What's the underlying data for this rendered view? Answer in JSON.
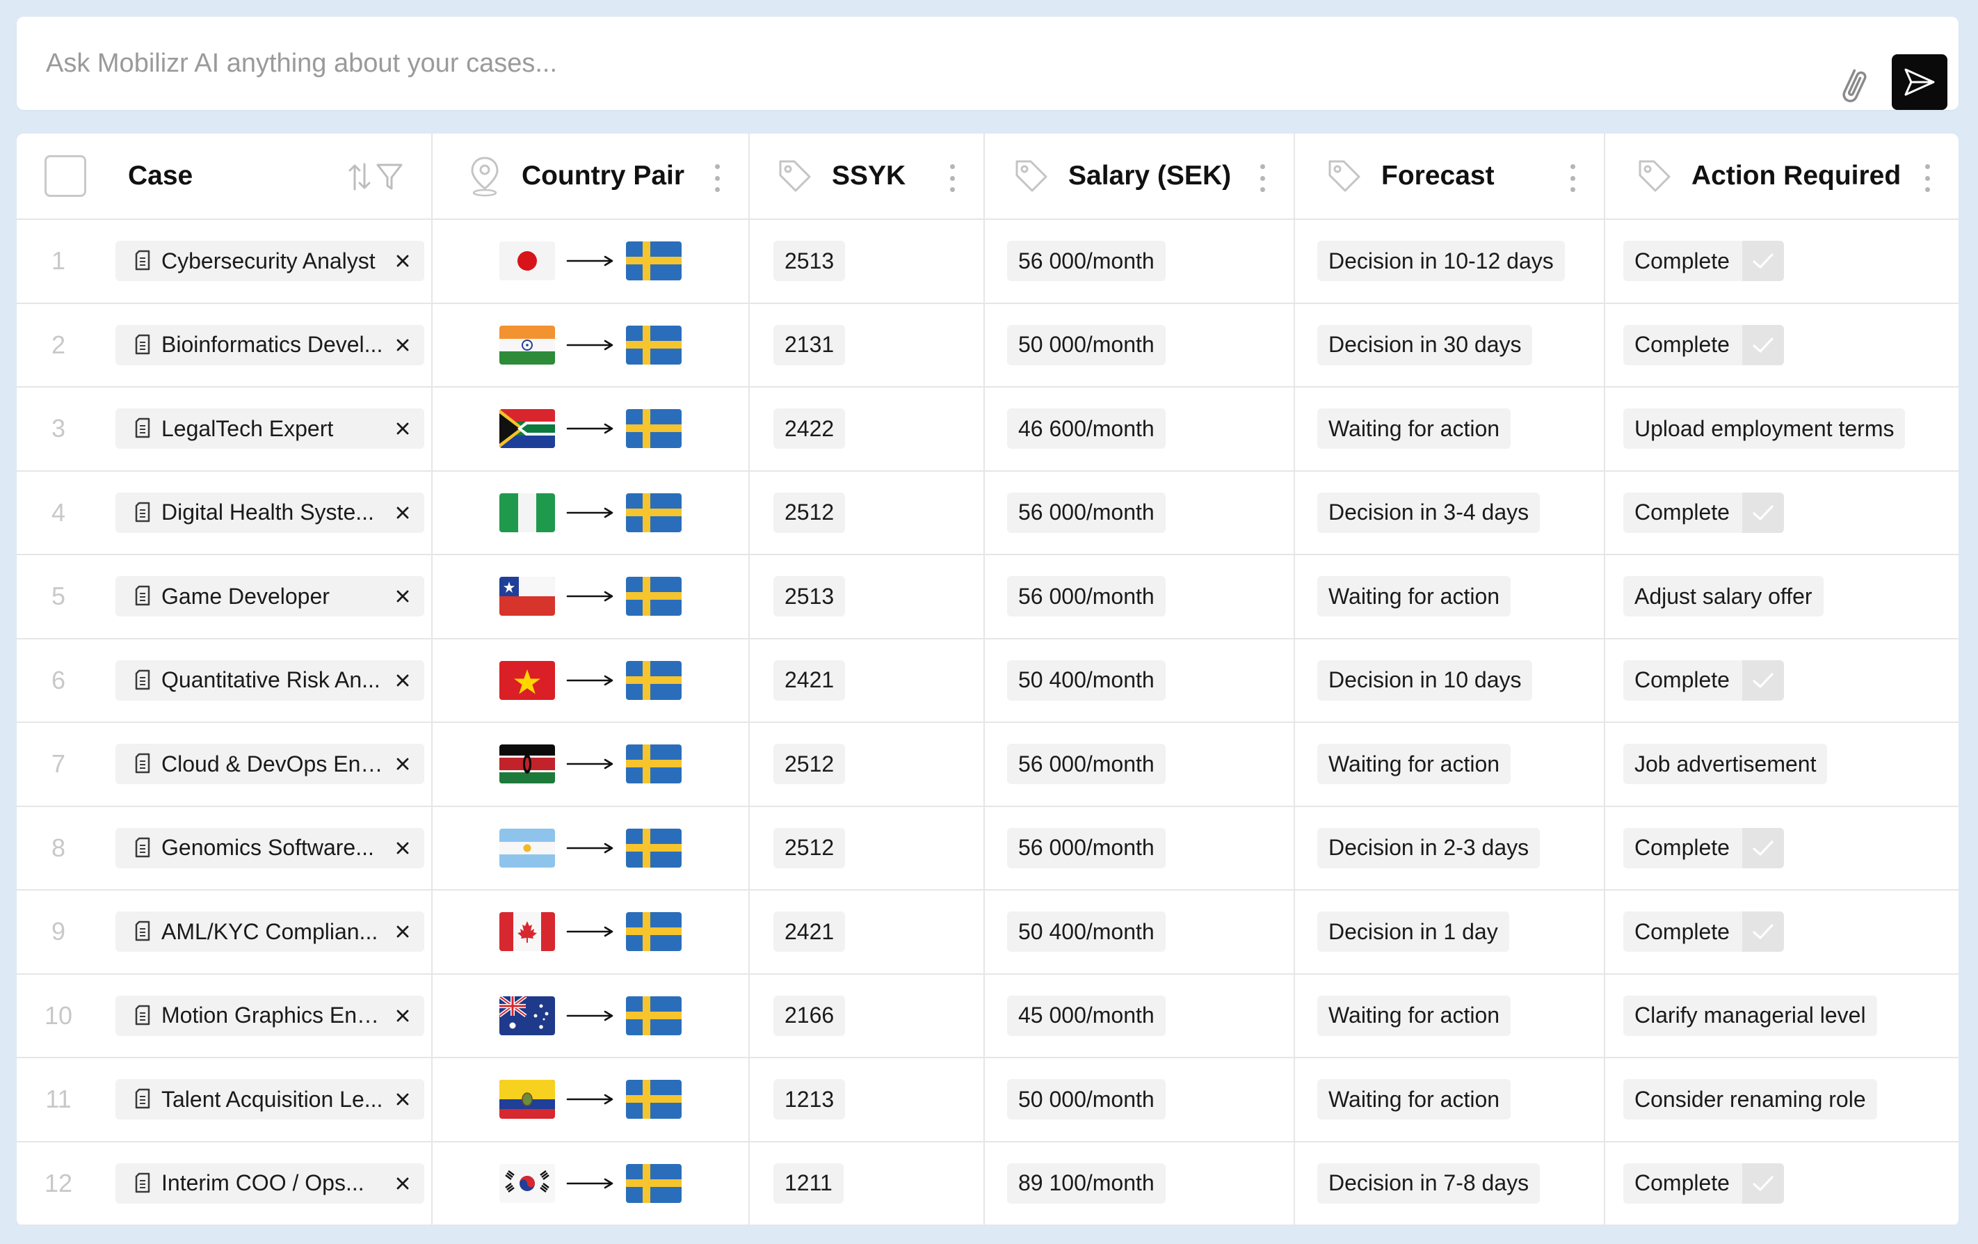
{
  "ask": {
    "placeholder": "Ask Mobilizr AI anything about your cases...",
    "attach_icon": "paperclip-icon",
    "send_icon": "send-icon"
  },
  "columns": [
    {
      "label": "Case",
      "icon": "checkbox"
    },
    {
      "label": "Country Pair",
      "icon": "location-pin-icon"
    },
    {
      "label": "SSYK",
      "icon": "tag-icon"
    },
    {
      "label": "Salary (SEK)",
      "icon": "tag-icon"
    },
    {
      "label": "Forecast",
      "icon": "tag-icon"
    },
    {
      "label": "Action Required",
      "icon": "tag-icon"
    }
  ],
  "rows": [
    {
      "num": "1",
      "case": "Cybersecurity Analyst",
      "from": "japan",
      "to": "sweden",
      "ssyk": "2513",
      "salary": "56 000/month",
      "forecast": "Decision in 10-12 days",
      "action": "Complete",
      "complete": true
    },
    {
      "num": "2",
      "case": "Bioinformatics Devel...",
      "from": "india",
      "to": "sweden",
      "ssyk": "2131",
      "salary": "50 000/month",
      "forecast": "Decision in 30 days",
      "action": "Complete",
      "complete": true
    },
    {
      "num": "3",
      "case": "LegalTech Expert",
      "from": "south-africa",
      "to": "sweden",
      "ssyk": "2422",
      "salary": "46 600/month",
      "forecast": "Waiting for action",
      "action": "Upload employment terms",
      "complete": false
    },
    {
      "num": "4",
      "case": "Digital Health Syste...",
      "from": "nigeria",
      "to": "sweden",
      "ssyk": "2512",
      "salary": "56 000/month",
      "forecast": "Decision in 3-4 days",
      "action": "Complete",
      "complete": true
    },
    {
      "num": "5",
      "case": "Game Developer",
      "from": "chile",
      "to": "sweden",
      "ssyk": "2513",
      "salary": "56 000/month",
      "forecast": "Waiting for action",
      "action": "Adjust salary offer",
      "complete": false
    },
    {
      "num": "6",
      "case": "Quantitative Risk An...",
      "from": "vietnam",
      "to": "sweden",
      "ssyk": "2421",
      "salary": "50 400/month",
      "forecast": "Decision in 10 days",
      "action": "Complete",
      "complete": true
    },
    {
      "num": "7",
      "case": "Cloud & DevOps Eng...",
      "from": "kenya",
      "to": "sweden",
      "ssyk": "2512",
      "salary": "56 000/month",
      "forecast": "Waiting for action",
      "action": "Job advertisement",
      "complete": false
    },
    {
      "num": "8",
      "case": "Genomics Software...",
      "from": "argentina",
      "to": "sweden",
      "ssyk": "2512",
      "salary": "56 000/month",
      "forecast": "Decision in 2-3 days",
      "action": "Complete",
      "complete": true
    },
    {
      "num": "9",
      "case": "AML/KYC Complian...",
      "from": "canada",
      "to": "sweden",
      "ssyk": "2421",
      "salary": "50 400/month",
      "forecast": "Decision in 1 day",
      "action": "Complete",
      "complete": true
    },
    {
      "num": "10",
      "case": "Motion Graphics Eng...",
      "from": "australia",
      "to": "sweden",
      "ssyk": "2166",
      "salary": "45 000/month",
      "forecast": "Waiting for action",
      "action": "Clarify managerial level",
      "complete": false
    },
    {
      "num": "11",
      "case": "Talent Acquisition Le...",
      "from": "ecuador",
      "to": "sweden",
      "ssyk": "1213",
      "salary": "50 000/month",
      "forecast": "Waiting for action",
      "action": "Consider renaming role",
      "complete": false
    },
    {
      "num": "12",
      "case": "Interim COO / Ops...",
      "from": "south-korea",
      "to": "sweden",
      "ssyk": "1211",
      "salary": "89 100/month",
      "forecast": "Decision in 7-8 days",
      "action": "Complete",
      "complete": true
    }
  ]
}
